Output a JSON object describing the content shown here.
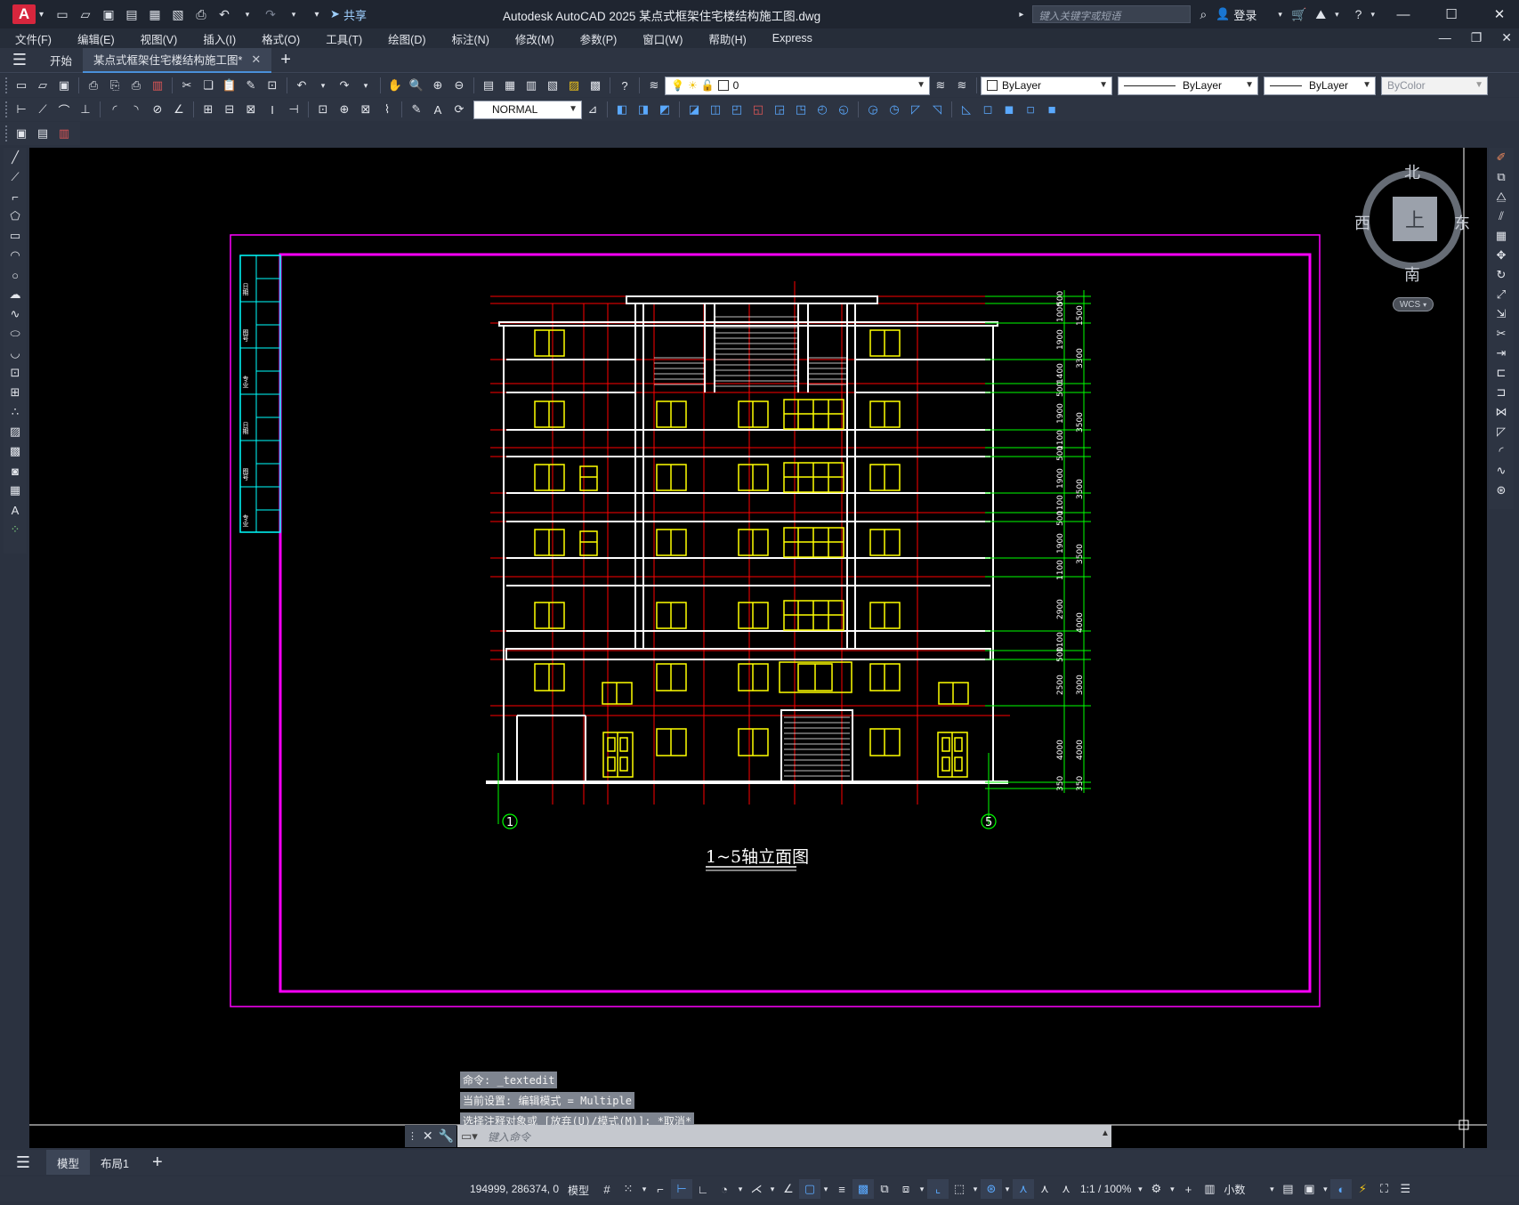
{
  "app": {
    "title": "Autodesk AutoCAD 2025    某点式框架住宅楼结构施工图.dwg",
    "logo": "A",
    "share_label": "共享",
    "search_placeholder": "键入关键字或短语",
    "login_label": "登录"
  },
  "menu": [
    "文件(F)",
    "编辑(E)",
    "视图(V)",
    "插入(I)",
    "格式(O)",
    "工具(T)",
    "绘图(D)",
    "标注(N)",
    "修改(M)",
    "参数(P)",
    "窗口(W)",
    "帮助(H)",
    "Express"
  ],
  "tabs": [
    {
      "label": "开始"
    },
    {
      "label": "某点式框架住宅楼结构施工图*"
    }
  ],
  "toolbar": {
    "layer_value": "0",
    "color_value": "ByLayer",
    "linetype_value": "ByLayer",
    "lineweight_value": "ByLayer",
    "plotstyle_value": "ByColor",
    "dimstyle_value": "NORMAL"
  },
  "viewcube": {
    "north": "北",
    "south": "南",
    "east": "东",
    "west": "西",
    "top": "上",
    "wcs": "WCS"
  },
  "drawing": {
    "title": "1~5轴立面图",
    "axis_left": "1",
    "axis_right": "5",
    "dims_left": [
      "500",
      "1000",
      "1900",
      "1400",
      "500",
      "1900",
      "1100",
      "500",
      "1900",
      "1100",
      "500",
      "1900",
      "1100",
      "2900",
      "1100",
      "500",
      "2500",
      "4000",
      "350"
    ],
    "dims_right": [
      "1500",
      "3300",
      "3500",
      "3500",
      "3500",
      "4000",
      "3000",
      "4000",
      "350"
    ],
    "titleblock_labels": [
      "日期",
      "图号",
      "专业",
      "日期",
      "图号",
      "专业"
    ]
  },
  "command": {
    "history": [
      "命令: _textedit",
      "当前设置: 编辑模式 = Multiple",
      "选择注释对象或 [放弃(U)/模式(M)]: *取消*"
    ],
    "placeholder": "键入命令"
  },
  "layout_tabs": [
    {
      "label": "模型"
    },
    {
      "label": "布局1"
    }
  ],
  "status": {
    "coords": "194999, 286374, 0",
    "model_label": "模型",
    "scale_label": "1:1 / 100%",
    "units_label": "小数"
  }
}
